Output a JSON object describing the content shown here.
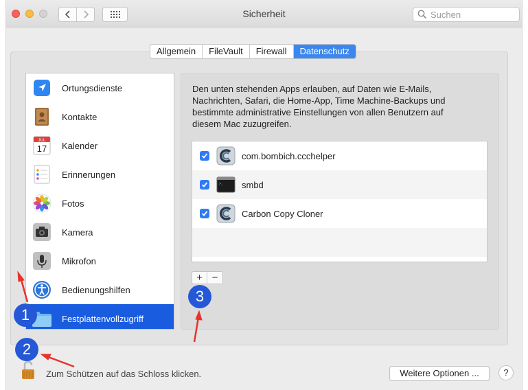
{
  "window": {
    "title": "Sicherheit",
    "search_placeholder": "Suchen"
  },
  "tabs": [
    {
      "label": "Allgemein",
      "active": false
    },
    {
      "label": "FileVault",
      "active": false
    },
    {
      "label": "Firewall",
      "active": false
    },
    {
      "label": "Datenschutz",
      "active": true
    }
  ],
  "sidebar": {
    "items": [
      {
        "label": "Ortungsdienste",
        "icon": "location-arrow-icon"
      },
      {
        "label": "Kontakte",
        "icon": "contacts-book-icon"
      },
      {
        "label": "Kalender",
        "icon": "calendar-icon",
        "calendar_month": "JUL",
        "calendar_day": "17"
      },
      {
        "label": "Erinnerungen",
        "icon": "reminders-icon"
      },
      {
        "label": "Fotos",
        "icon": "photos-flower-icon"
      },
      {
        "label": "Kamera",
        "icon": "camera-icon"
      },
      {
        "label": "Mikrofon",
        "icon": "microphone-icon"
      },
      {
        "label": "Bedienungshilfen",
        "icon": "accessibility-icon"
      },
      {
        "label": "Festplattenvollzugriff",
        "icon": "folder-icon",
        "selected": true
      }
    ]
  },
  "panel": {
    "description": "Den unten stehenden Apps erlauben, auf Daten wie E-Mails, Nachrichten, Safari, die Home-App, Time Machine-Backups und bestimmte administrative Einstellungen von allen Benutzern auf diesem Mac zuzugreifen.",
    "apps": [
      {
        "name": "com.bombich.ccchelper",
        "checked": true,
        "icon": "ccc-icon"
      },
      {
        "name": "smbd",
        "checked": true,
        "icon": "terminal-icon"
      },
      {
        "name": "Carbon Copy Cloner",
        "checked": true,
        "icon": "ccc-icon"
      }
    ],
    "add_label": "+",
    "remove_label": "−"
  },
  "footer": {
    "lock_text": "Zum Schützen auf das Schloss klicken.",
    "more_options": "Weitere Optionen ...",
    "help": "?"
  },
  "annotations": {
    "badge1": "1",
    "badge2": "2",
    "badge3": "3"
  },
  "colors": {
    "selection": "#1a5ce0",
    "active_tab": "#3b87ef",
    "checkbox": "#2f7bf5",
    "annotation_badge": "#2458d6",
    "annotation_arrow": "#e8322a"
  }
}
